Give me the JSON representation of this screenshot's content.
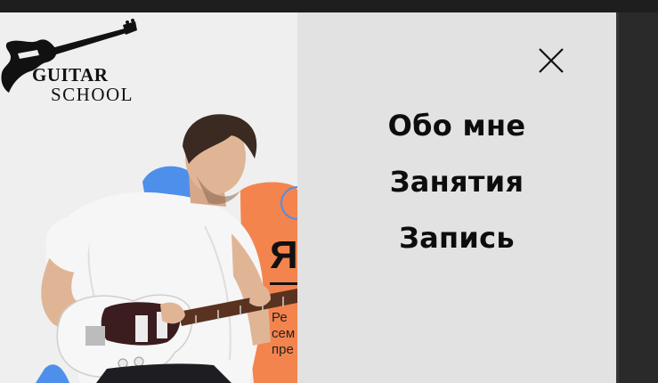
{
  "logo": {
    "line1": "GUITAR",
    "line2": "SCHOOL",
    "icon": "electric-guitar-silhouette"
  },
  "hero": {
    "peek_heading": "Я",
    "peek_lines": [
      "Ре",
      "сем",
      "пре"
    ]
  },
  "menu": {
    "close_icon": "close-x-icon",
    "items": [
      {
        "label": "Обо мне"
      },
      {
        "label": "Занятия"
      },
      {
        "label": "Запись"
      }
    ]
  },
  "colors": {
    "menu_bg": "#e2e2e2",
    "page_bg": "#efefef",
    "accent_blue": "#4d8fea",
    "accent_orange": "#f4844e",
    "text": "#0d0d0d"
  }
}
